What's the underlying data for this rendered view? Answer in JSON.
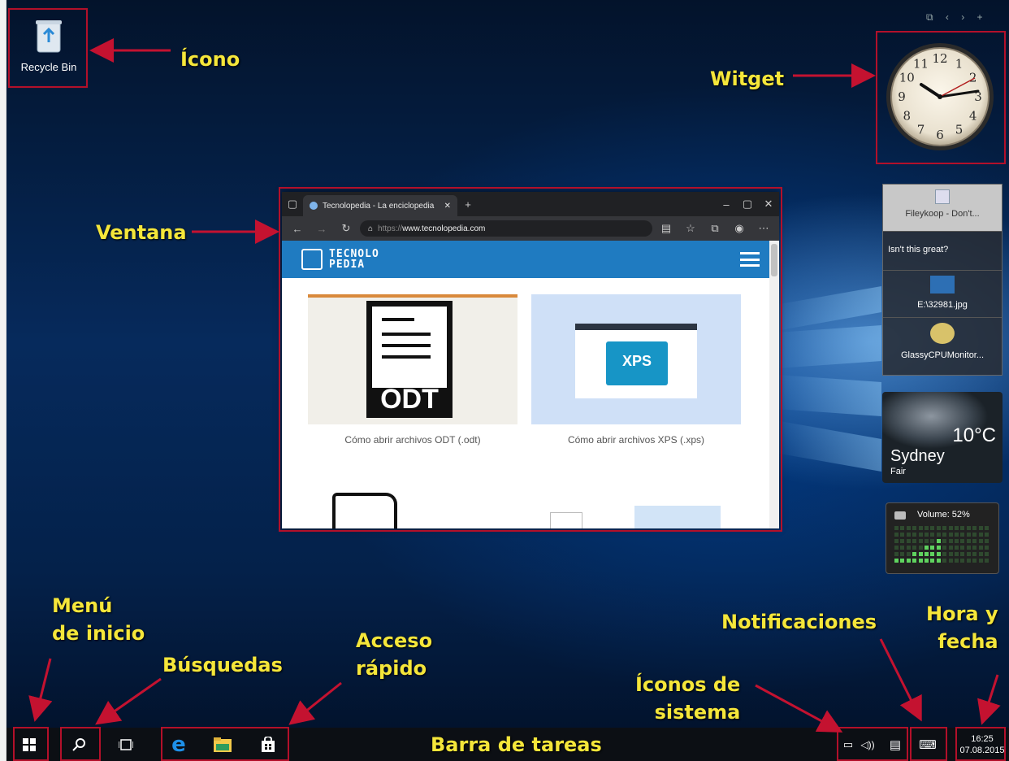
{
  "desktop": {
    "recycle_bin_label": "Recycle Bin"
  },
  "annotations": {
    "icono": "Ícono",
    "witget": "Witget",
    "ventana": "Ventana",
    "menu_line1": "Menú",
    "menu_line2": "de inicio",
    "busquedas": "Búsquedas",
    "acceso_line1": "Acceso",
    "acceso_line2": "rápido",
    "barra": "Barra de tareas",
    "iconos_line1": "Íconos de",
    "iconos_line2": "sistema",
    "notificaciones": "Notificaciones",
    "hora_line1": "Hora y",
    "hora_line2": "fecha"
  },
  "browser": {
    "tab_title": "Tecnolopedia - La enciclopedia",
    "url_prefix": "https://",
    "url_host": "www.tecnolopedia.com",
    "logo_line1": "TECNOLO",
    "logo_line2": "PEDIA",
    "cards": [
      {
        "thumb_text": "ODT",
        "caption": "Cómo abrir archivos ODT (.odt)"
      },
      {
        "thumb_text": "XPS",
        "caption": "Cómo abrir archivos XPS (.xps)"
      }
    ]
  },
  "clock_gadget": {
    "numbers": [
      "12",
      "1",
      "2",
      "3",
      "4",
      "5",
      "6",
      "7",
      "8",
      "9",
      "10",
      "11"
    ]
  },
  "slideshow": {
    "items": [
      "Fileykoop - Don't...",
      "Isn't this great?",
      "E:\\32981.jpg",
      "GlassyCPUMonitor..."
    ]
  },
  "weather": {
    "temperature": "10°C",
    "city": "Sydney",
    "condition": "Fair"
  },
  "volume_gadget": {
    "label": "Volume: 52%",
    "level": 0.52
  },
  "taskbar": {
    "time": "16:25",
    "date": "07.08.2015"
  },
  "colors": {
    "annotation_text": "#f5e63a",
    "annotation_box": "#b3102a",
    "site_header": "#1f7bc1"
  }
}
